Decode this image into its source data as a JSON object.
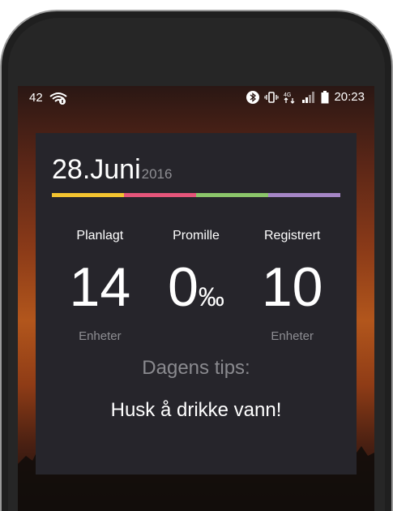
{
  "statusbar": {
    "left_number": "42",
    "time": "20:23",
    "icons": [
      "wifi-icon",
      "bluetooth-icon",
      "vibrate-icon",
      "data-4g-icon",
      "signal-icon",
      "battery-icon"
    ]
  },
  "widget": {
    "date": "28.Juni",
    "year": "2016",
    "colorbar_colors": [
      "#f4c430",
      "#e5557a",
      "#8bc56a",
      "#a586c6"
    ],
    "stats": [
      {
        "label": "Planlagt",
        "value": "14",
        "unit": "",
        "sub": "Enheter"
      },
      {
        "label": "Promille",
        "value": "0",
        "unit": "‰",
        "sub": ""
      },
      {
        "label": "Registrert",
        "value": "10",
        "unit": "",
        "sub": "Enheter"
      }
    ],
    "tips_title": "Dagens tips:",
    "tips_text": "Husk å drikke vann!"
  },
  "colors": {
    "widget_bg": "#26252b",
    "muted_text": "#8e8e93"
  }
}
